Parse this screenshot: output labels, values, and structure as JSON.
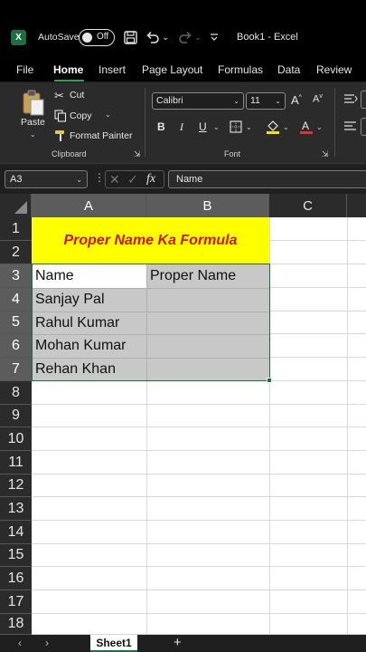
{
  "titlebar": {
    "app_icon": "X",
    "autosave_label": "AutoSave",
    "autosave_state": "Off",
    "document_title": "Book1 - Excel"
  },
  "tabs": [
    "File",
    "Home",
    "Insert",
    "Page Layout",
    "Formulas",
    "Data",
    "Review"
  ],
  "ribbon": {
    "clipboard": {
      "paste": "Paste",
      "cut": "Cut",
      "copy": "Copy",
      "format_painter": "Format Painter",
      "group_label": "Clipboard"
    },
    "font": {
      "font_name": "Calibri",
      "font_size": "11",
      "bold": "B",
      "italic": "I",
      "underline": "U",
      "group_label": "Font",
      "fill_color": "#f2e600",
      "font_color": "#e03030"
    }
  },
  "formula_bar": {
    "name_box": "A3",
    "fx": "fx",
    "content": "Name"
  },
  "grid": {
    "columns": [
      "A",
      "B",
      "C"
    ],
    "rows": [
      "1",
      "2",
      "3",
      "4",
      "5",
      "6",
      "7",
      "8",
      "9",
      "10",
      "11",
      "12",
      "13",
      "14",
      "15",
      "16",
      "17",
      "18"
    ],
    "title": "Proper Name Ka Formula",
    "title_color": "#d0121b",
    "title_fill": "#ffff00",
    "header_a": "Name",
    "header_b": "Proper Name",
    "names": [
      "Sanjay Pal",
      "Rahul Kumar",
      "Mohan Kumar",
      "Rehan Khan"
    ],
    "selection_fill": "#c8c8c8",
    "accent": "#1d6f42"
  },
  "sheets": {
    "active": "Sheet1",
    "add": "+"
  }
}
